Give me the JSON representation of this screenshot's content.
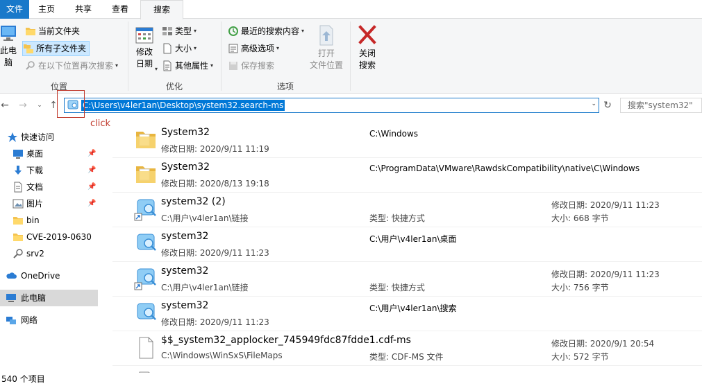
{
  "tabs": [
    {
      "label": "文件"
    },
    {
      "label": "主页"
    },
    {
      "label": "共享"
    },
    {
      "label": "查看"
    },
    {
      "label": "搜索"
    }
  ],
  "ribbon": {
    "location": {
      "this_pc_label": "此电\n脑",
      "current_folder": "当前文件夹",
      "all_subfolders": "所有子文件夹",
      "search_again_in": "在以下位置再次搜索",
      "group_label": "位置"
    },
    "refine": {
      "date_modified": "修改\n日期",
      "kind": "类型",
      "size": "大小",
      "other_properties": "其他属性",
      "group_label": "优化"
    },
    "options": {
      "recent_searches": "最近的搜索内容",
      "advanced_options": "高级选项",
      "save_search": "保存搜索",
      "open_location": "打开\n文件位置",
      "close_search": "关闭\n搜索",
      "group_label": "选项"
    }
  },
  "addressbar": {
    "path": "C:\\Users\\v4ler1an\\Desktop\\system32.search-ms",
    "search_placeholder": "搜索\"system32\""
  },
  "annotation": {
    "click_label": "click"
  },
  "sidebar": {
    "items": [
      {
        "label": "快速访问",
        "icon": "star-icon",
        "pinned": false
      },
      {
        "label": "桌面",
        "icon": "desktop-icon",
        "pinned": true
      },
      {
        "label": "下载",
        "icon": "download-icon",
        "pinned": true
      },
      {
        "label": "文档",
        "icon": "document-icon",
        "pinned": true
      },
      {
        "label": "图片",
        "icon": "picture-icon",
        "pinned": true
      },
      {
        "label": "bin",
        "icon": "folder-icon",
        "pinned": false
      },
      {
        "label": "CVE-2019-0630",
        "icon": "folder-icon",
        "pinned": false
      },
      {
        "label": "srv2",
        "icon": "search-icon",
        "pinned": false
      },
      {
        "label": "OneDrive",
        "icon": "cloud-icon",
        "pinned": false
      },
      {
        "label": "此电脑",
        "icon": "computer-icon",
        "pinned": false
      },
      {
        "label": "网络",
        "icon": "network-icon",
        "pinned": false
      }
    ]
  },
  "files": [
    {
      "name": "System32",
      "sub": "修改日期: 2020/9/11 11:19",
      "path": "C:\\Windows",
      "type": "",
      "date": "",
      "size": "",
      "icon": "folder-icon"
    },
    {
      "name": "System32",
      "sub": "修改日期: 2020/8/13 19:18",
      "path": "C:\\ProgramData\\VMware\\RawdskCompatibility\\native\\C\\Windows",
      "type": "",
      "date": "",
      "size": "",
      "icon": "folder-icon"
    },
    {
      "name": "system32 (2)",
      "sub": "C:\\用户\\v4ler1an\\链接",
      "path": "",
      "type": "类型: 快捷方式",
      "date": "修改日期: 2020/9/11 11:23",
      "size": "大小: 668 字节",
      "icon": "search-shortcut-icon"
    },
    {
      "name": "system32",
      "sub": "修改日期: 2020/9/11 11:23",
      "path": "C:\\用户\\v4ler1an\\桌面",
      "type": "",
      "date": "",
      "size": "",
      "icon": "saved-search-icon"
    },
    {
      "name": "system32",
      "sub": "C:\\用户\\v4ler1an\\链接",
      "path": "",
      "type": "类型: 快捷方式",
      "date": "修改日期: 2020/9/11 11:23",
      "size": "大小: 756 字节",
      "icon": "search-shortcut-icon"
    },
    {
      "name": "system32",
      "sub": "修改日期: 2020/9/11 11:23",
      "path": "C:\\用户\\v4ler1an\\搜索",
      "type": "",
      "date": "",
      "size": "",
      "icon": "saved-search-icon"
    },
    {
      "name": "$$_system32_applocker_745949fdc87fdde1.cdf-ms",
      "sub": "C:\\Windows\\WinSxS\\FileMaps",
      "path": "",
      "type": "类型: CDF-MS 文件",
      "date": "修改日期: 2020/9/1 20:54",
      "size": "大小: 572 字节",
      "icon": "file-icon"
    }
  ],
  "status": {
    "count": "540 个项目"
  }
}
